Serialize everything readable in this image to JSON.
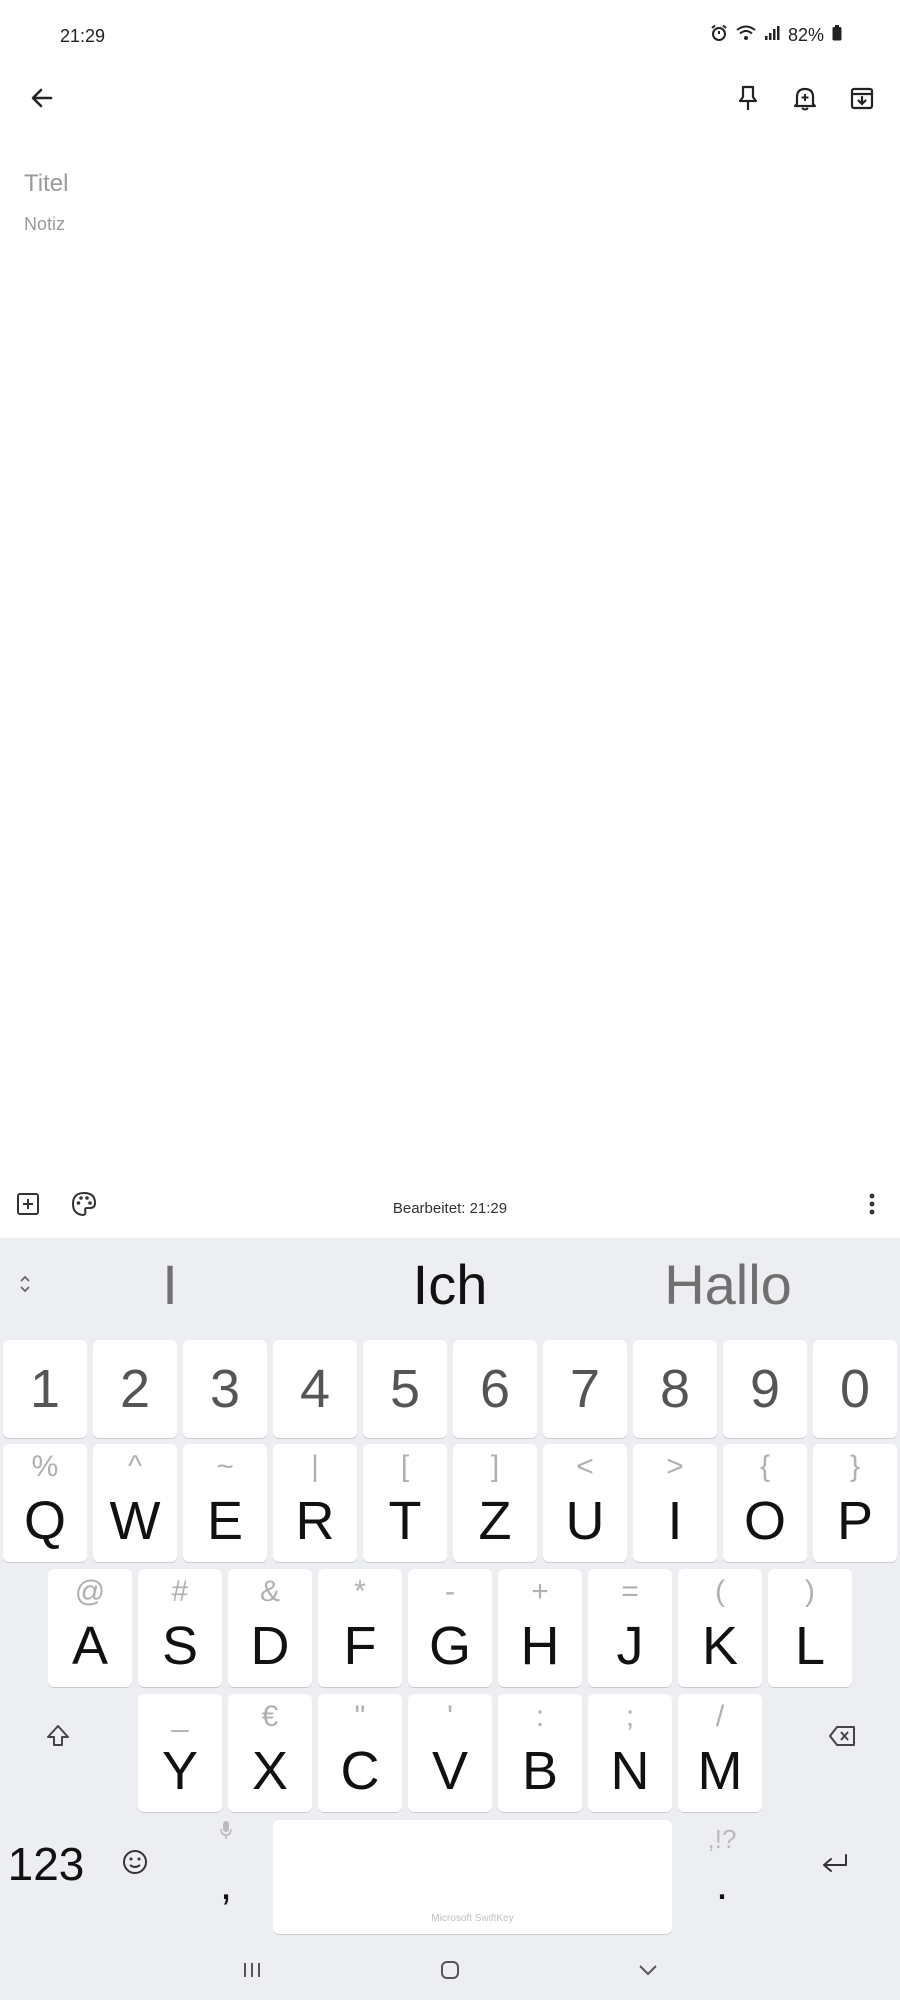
{
  "status_bar": {
    "time": "21:29",
    "battery": "82%"
  },
  "icons": {
    "back": "arrow-left-icon",
    "pin": "pin-icon",
    "reminder": "bell-plus-icon",
    "archive": "archive-icon",
    "add": "add-box-icon",
    "palette": "palette-icon",
    "more": "more-vert-icon"
  },
  "note": {
    "title_placeholder": "Titel",
    "body_placeholder": "Notiz"
  },
  "toolbar": {
    "edited": "Bearbeitet: 21:29"
  },
  "keyboard": {
    "suggestions": [
      "I",
      "Ich",
      "Hallo"
    ],
    "numbers": [
      "1",
      "2",
      "3",
      "4",
      "5",
      "6",
      "7",
      "8",
      "9",
      "0"
    ],
    "row1": [
      {
        "sec": "%",
        "key": "Q"
      },
      {
        "sec": "^",
        "key": "W"
      },
      {
        "sec": "~",
        "key": "E"
      },
      {
        "sec": "|",
        "key": "R"
      },
      {
        "sec": "[",
        "key": "T"
      },
      {
        "sec": "]",
        "key": "Z"
      },
      {
        "sec": "<",
        "key": "U"
      },
      {
        "sec": ">",
        "key": "I"
      },
      {
        "sec": "{",
        "key": "O"
      },
      {
        "sec": "}",
        "key": "P"
      }
    ],
    "row2": [
      {
        "sec": "@",
        "key": "A"
      },
      {
        "sec": "#",
        "key": "S"
      },
      {
        "sec": "&",
        "key": "D"
      },
      {
        "sec": "*",
        "key": "F"
      },
      {
        "sec": "-",
        "key": "G"
      },
      {
        "sec": "+",
        "key": "H"
      },
      {
        "sec": "=",
        "key": "J"
      },
      {
        "sec": "(",
        "key": "K"
      },
      {
        "sec": ")",
        "key": "L"
      }
    ],
    "row3": [
      {
        "sec": "_",
        "key": "Y"
      },
      {
        "sec": "€",
        "key": "X"
      },
      {
        "sec": "\"",
        "key": "C"
      },
      {
        "sec": "'",
        "key": "V"
      },
      {
        "sec": ":",
        "key": "B"
      },
      {
        "sec": ";",
        "key": "N"
      },
      {
        "sec": "/",
        "key": "M"
      }
    ],
    "numbers_key": "123",
    "comma": ",",
    "period": ".",
    "punct_hint": ",!?",
    "space_brand": "Microsoft SwiftKey"
  }
}
